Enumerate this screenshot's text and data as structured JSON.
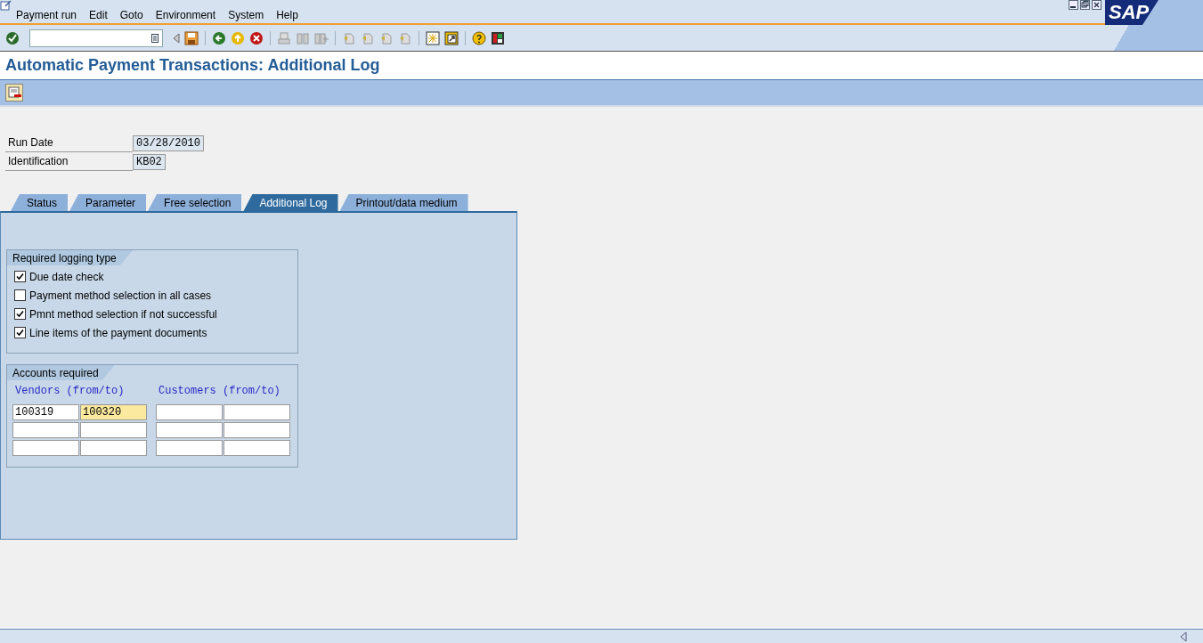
{
  "menu_bar": {
    "items": [
      "Payment run",
      "Edit",
      "Goto",
      "Environment",
      "System",
      "Help"
    ]
  },
  "logo": {
    "text": "SAP"
  },
  "title": "Automatic Payment Transactions: Additional Log",
  "header_fields": [
    {
      "label": "Run Date",
      "value": "03/28/2010"
    },
    {
      "label": "Identification",
      "value": "KB02"
    }
  ],
  "tabs": [
    {
      "label": "Status",
      "selected": false
    },
    {
      "label": "Parameter",
      "selected": false
    },
    {
      "label": "Free selection",
      "selected": false
    },
    {
      "label": "Additional Log",
      "selected": true
    },
    {
      "label": "Printout/data medium",
      "selected": false
    }
  ],
  "logging_group": {
    "title": "Required logging type",
    "options": [
      {
        "label": "Due date check",
        "checked": true
      },
      {
        "label": "Payment method selection in all cases",
        "checked": false
      },
      {
        "label": "Pmnt method selection if not successful",
        "checked": true
      },
      {
        "label": "Line items of the payment documents",
        "checked": true
      }
    ]
  },
  "accounts_group": {
    "title": "Accounts required",
    "vendors_label": "Vendors (from/to)",
    "customers_label": "Customers (from/to)",
    "rows": [
      [
        {
          "value": "100319",
          "focused": false
        },
        {
          "value": "100320",
          "focused": true
        },
        {
          "focused": false
        },
        {
          "focused": false
        }
      ],
      [
        {
          "focused": false
        },
        {
          "focused": false
        },
        {
          "focused": false
        },
        {
          "focused": false
        }
      ],
      [
        {
          "focused": false
        },
        {
          "focused": false
        },
        {
          "focused": false
        },
        {
          "focused": false
        }
      ]
    ]
  }
}
